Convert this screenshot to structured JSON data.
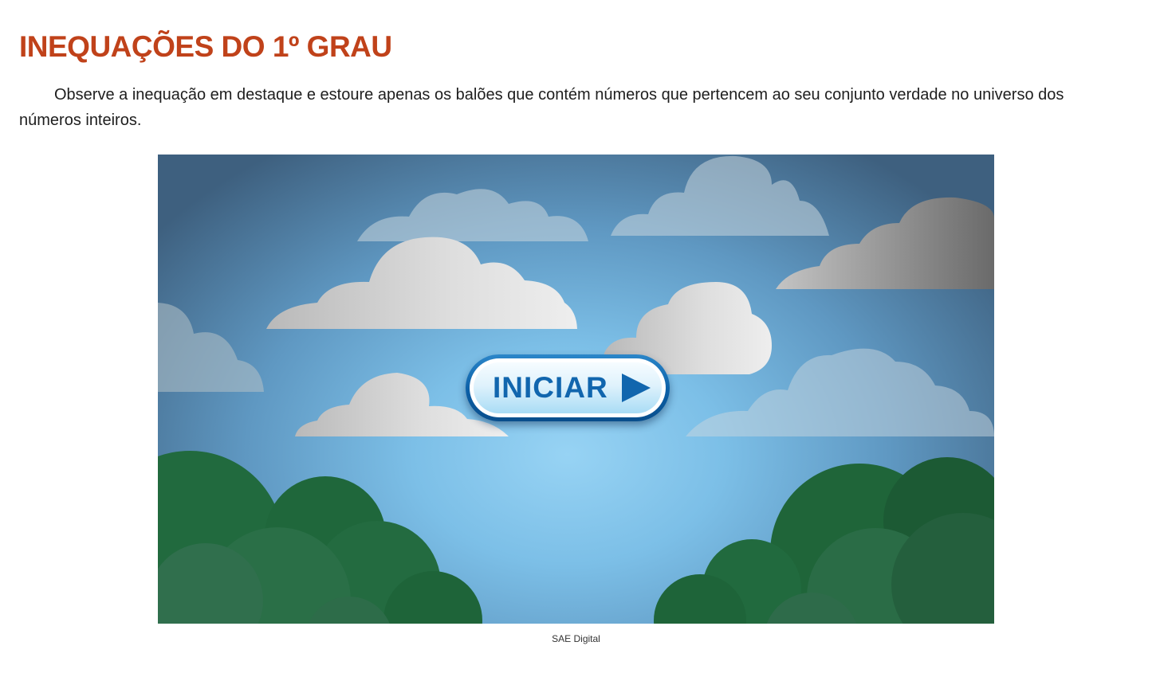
{
  "page": {
    "title": "INEQUAÇÕES DO 1º GRAU",
    "instructions": "Observe a inequação em destaque e estoure apenas os balões que contém números que pertencem ao seu conjunto verdade no universo dos números inteiros."
  },
  "game": {
    "start_button_label": "INICIAR",
    "start_button_icon": "play-icon",
    "accent_color": "#1166ae"
  },
  "caption": "SAE Digital",
  "colors": {
    "title": "#c0421a",
    "sky": "#7cbfe7",
    "foliage": "#1f6a3d"
  }
}
